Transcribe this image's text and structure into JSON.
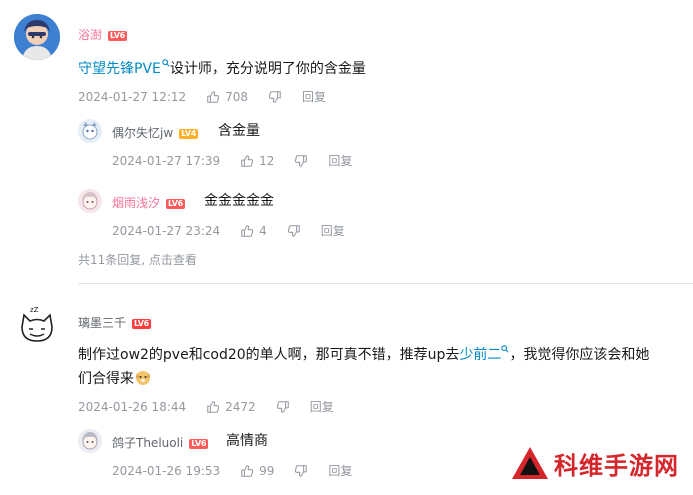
{
  "comments": [
    {
      "username": "浴澍",
      "level": "LV6",
      "content": {
        "link": "守望先锋PVE",
        "text": "设计师，充分说明了你的含金量"
      },
      "time": "2024-01-27 12:12",
      "likes": "708",
      "reply_label": "回复",
      "replies": [
        {
          "username": "偶尔失忆jw",
          "level": "LV4",
          "text": "含金量",
          "time": "2024-01-27 17:39",
          "likes": "12",
          "reply_label": "回复"
        },
        {
          "username": "烟雨浅汐",
          "level": "LV6",
          "text": "金金金金金",
          "time": "2024-01-27 23:24",
          "likes": "4",
          "reply_label": "回复"
        }
      ],
      "more_replies": "共11条回复, 点击查看"
    },
    {
      "username": "璃墨三千",
      "level": "LV6",
      "content": {
        "part1": "制作过ow2的pve和cod20的单人啊，那可真不错，推荐up去",
        "link": "少前二",
        "part2": "，我觉得你应该会和她",
        "line2": "们合得来"
      },
      "time": "2024-01-26 18:44",
      "likes": "2472",
      "reply_label": "回复",
      "replies": [
        {
          "username": "鸽子Theluoli",
          "level": "LV6",
          "text": "高情商",
          "time": "2024-01-26 19:53",
          "likes": "99",
          "reply_label": "回复"
        }
      ]
    }
  ],
  "watermark": {
    "text": "科维手游网"
  },
  "colors": {
    "pink_name": "#fb7299",
    "link": "#008ac5",
    "meta": "#9499a0"
  }
}
